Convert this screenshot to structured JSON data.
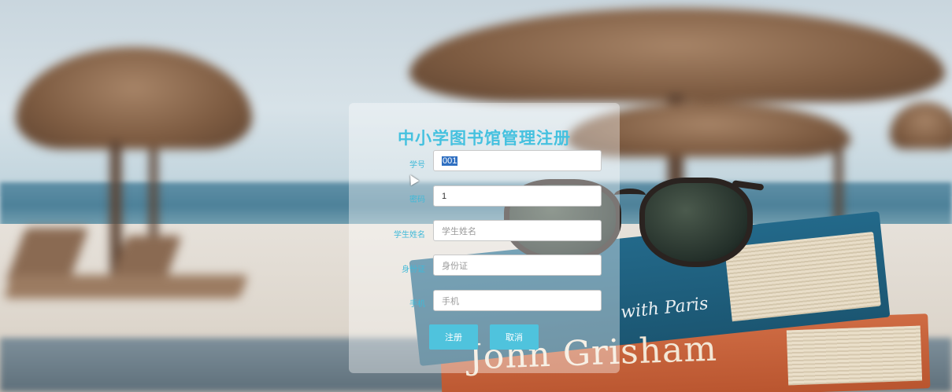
{
  "page": {
    "title": "中小学图书馆管理注册"
  },
  "form": {
    "fields": [
      {
        "label": "学号",
        "value": "001",
        "placeholder": ""
      },
      {
        "label": "密码",
        "value": "1",
        "placeholder": ""
      },
      {
        "label": "学生姓名",
        "value": "",
        "placeholder": "学生姓名"
      },
      {
        "label": "身份证",
        "value": "",
        "placeholder": "身份证"
      },
      {
        "label": "手机",
        "value": "",
        "placeholder": "手机"
      }
    ],
    "register_label": "注册",
    "cancel_label": "取消"
  },
  "background": {
    "book_title": "John Grisham",
    "book_spine_text": "with Paris"
  },
  "colors": {
    "accent": "#45c1df",
    "button": "#4fc3dd"
  }
}
